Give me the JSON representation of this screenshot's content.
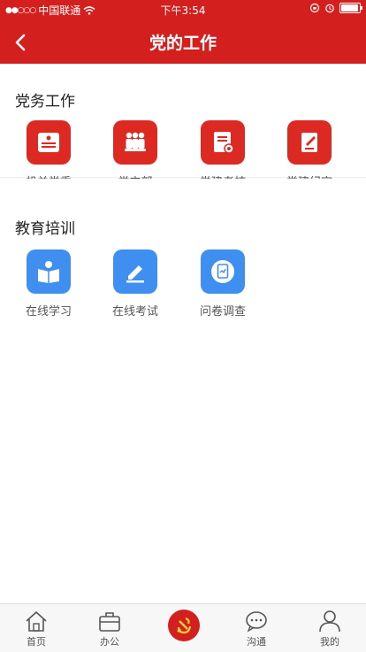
{
  "status_bar": {
    "signal": "●●○○○",
    "carrier": "中国联通",
    "time": "下午3:54",
    "battery_level": 0.95
  },
  "header": {
    "title": "党的工作"
  },
  "sections": [
    {
      "title": "党务工作",
      "items": [
        {
          "label": "机关党委",
          "icon": "certificate-icon"
        },
        {
          "label": "党支部",
          "icon": "group-icon"
        },
        {
          "label": "党建考核",
          "icon": "assessment-icon"
        },
        {
          "label": "党建纪实",
          "icon": "record-icon"
        }
      ]
    },
    {
      "title": "教育培训",
      "items": [
        {
          "label": "在线学习",
          "icon": "reading-icon"
        },
        {
          "label": "在线考试",
          "icon": "pen-icon"
        },
        {
          "label": "问卷调查",
          "icon": "survey-icon"
        }
      ]
    }
  ],
  "tabbar": [
    {
      "label": "首页",
      "icon": "home-icon"
    },
    {
      "label": "办公",
      "icon": "briefcase-icon"
    },
    {
      "label": "",
      "icon": "party-emblem-icon"
    },
    {
      "label": "沟通",
      "icon": "chat-icon"
    },
    {
      "label": "我的",
      "icon": "user-icon"
    }
  ],
  "colors": {
    "brand_red": "#d3201f",
    "icon_red": "#dc2a22",
    "icon_blue": "#3f8ff0"
  }
}
